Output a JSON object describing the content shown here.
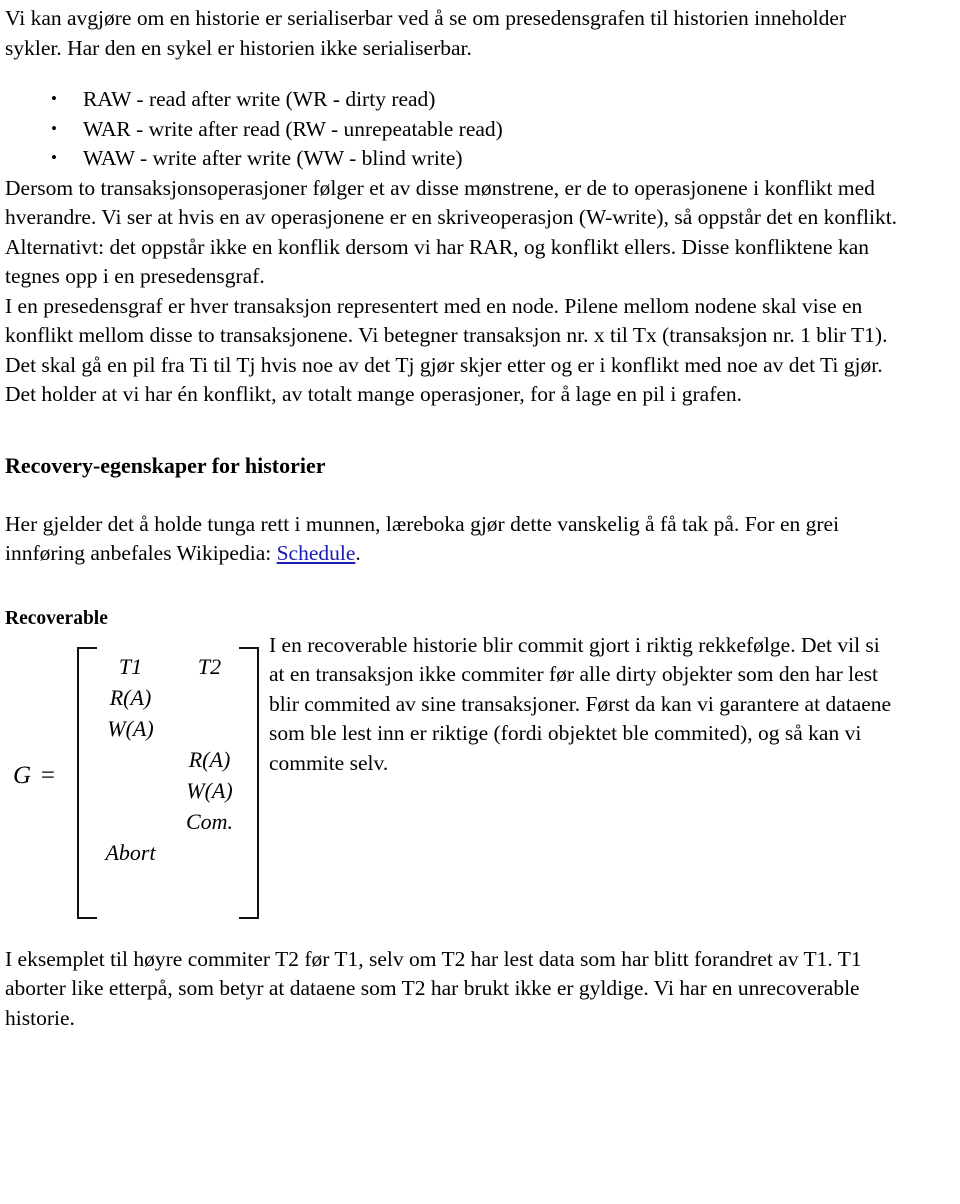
{
  "document": {
    "intro_paragraph": "Vi kan avgjøre om en historie er serialiserbar ved å se om presedensgrafen til historien inneholder sykler. Har den en sykel er historien ikke serialiserbar.",
    "conflict_types": [
      "RAW - read after write (WR - dirty read)",
      "WAR - write after read (RW - unrepeatable read)",
      "WAW - write after write (WW - blind write)"
    ],
    "conflict_paragraph": "Dersom to transaksjonsoperasjoner følger et av disse mønstrene, er de to operasjonene i konflikt med hverandre. Vi ser at hvis en av operasjonene er en skriveoperasjon (W-write), så oppstår det en konflikt. Alternativt: det oppstår ikke en konflik dersom vi har RAR, og konflikt ellers. Disse konfliktene kan tegnes opp i en presedensgraf.",
    "precedence_paragraph": "I en presedensgraf er hver transaksjon representert med en node. Pilene mellom nodene skal vise en konflikt mellom disse to transaksjonene. Vi betegner transaksjon nr. x til Tx (transaksjon nr. 1 blir T1). Det skal gå en pil fra Ti til Tj hvis noe av det Tj gjør skjer etter og er i konflikt med noe av det Ti gjør. Det holder at vi har én konflikt, av totalt mange operasjoner, for å lage en pil i grafen.",
    "recovery_heading": "Recovery-egenskaper for historier",
    "recovery_intro_before_link": "Her gjelder det å holde tunga rett i munnen, læreboka gjør dette vanskelig å få tak på. For en grei innføring anbefales Wikipedia: ",
    "recovery_link_label": "Schedule",
    "recovery_intro_after_link": ".",
    "recoverable_heading": "Recoverable",
    "recoverable_paragraph": "I en recoverable historie blir commit gjort i riktig rekkefølge. Det vil si at en transaksjon ikke commiter før alle dirty objekter som den har lest blir commited av sine transaksjoner. Først da kan vi garantere at dataene som ble lest inn er riktige (fordi objektet ble commited), og så kan vi commite selv.",
    "example_paragraph": "I eksemplet til høyre commiter T2 før T1, selv om T2 har lest data som har blitt forandret av T1. T1 aborter like etterpå, som betyr at dataene som T2 har brukt ikke er gyldige. Vi har en unrecoverable historie."
  },
  "schedule_figure": {
    "label": "G =",
    "columns": [
      "T1",
      "T2"
    ],
    "rows": [
      {
        "t1": "T1",
        "t2": "T2"
      },
      {
        "t1": "R(A)",
        "t2": ""
      },
      {
        "t1": "W(A)",
        "t2": ""
      },
      {
        "t1": "",
        "t2": "R(A)"
      },
      {
        "t1": "",
        "t2": "W(A)"
      },
      {
        "t1": "",
        "t2": "Com."
      },
      {
        "t1": "Abort",
        "t2": ""
      }
    ]
  },
  "colors": {
    "text": "#000000",
    "link": "#1a1ab4",
    "background": "#ffffff"
  }
}
